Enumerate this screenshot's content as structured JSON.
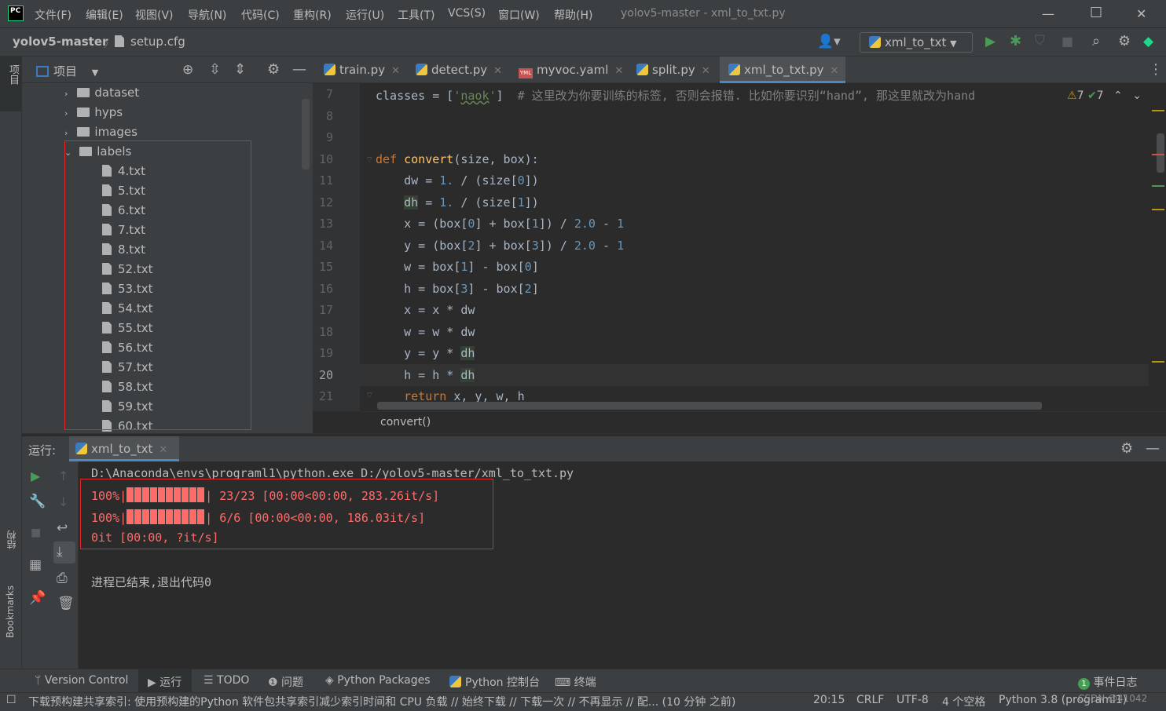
{
  "title_bar": {
    "logo": "PC",
    "menus": [
      "文件(F)",
      "编辑(E)",
      "视图(V)",
      "导航(N)",
      "代码(C)",
      "重构(R)",
      "运行(U)",
      "工具(T)",
      "VCS(S)",
      "窗口(W)",
      "帮助(H)"
    ],
    "window_title": "yolov5-master - xml_to_txt.py",
    "icons": [
      "minimize-icon",
      "maximize-icon",
      "close-icon"
    ]
  },
  "nav_bar": {
    "project": "yolov5-master",
    "separator": "〉",
    "file": "setup.cfg",
    "run_config": "xml_to_txt"
  },
  "left_strip": {
    "project_label": "项目",
    "structure_label": "结构",
    "bookmarks_label": "Bookmarks"
  },
  "project_panel": {
    "header": "项目",
    "folders": [
      "dataset",
      "hyps",
      "images",
      "labels"
    ],
    "files": [
      "4.txt",
      "5.txt",
      "6.txt",
      "7.txt",
      "8.txt",
      "52.txt",
      "53.txt",
      "54.txt",
      "55.txt",
      "56.txt",
      "57.txt",
      "58.txt",
      "59.txt",
      "60.txt"
    ]
  },
  "editor": {
    "tabs": [
      "train.py",
      "detect.py",
      "myvoc.yaml",
      "split.py",
      "xml_to_txt.py"
    ],
    "active_tab": "xml_to_txt.py",
    "line_numbers": [
      "7",
      "8",
      "9",
      "10",
      "11",
      "12",
      "13",
      "14",
      "15",
      "16",
      "17",
      "18",
      "19",
      "20",
      "21"
    ],
    "inspections": {
      "warnings": "7",
      "ok": "7"
    },
    "breadcrumb": "convert()"
  },
  "run_panel": {
    "label": "运行:",
    "tab": "xml_to_txt",
    "command": "D:\\Anaconda\\envs\\programl1\\python.exe D:/yolov5-master/xml_to_txt.py",
    "progress_lines": [
      {
        "pct": "100%|",
        "rest": "| 23/23 [00:00<00:00, 283.26it/s]"
      },
      {
        "pct": "100%|",
        "rest": "| 6/6 [00:00<00:00, 186.03it/s]"
      }
    ],
    "line3": "0it [00:00, ?it/s]",
    "exit_msg": "进程已结束,退出代码0"
  },
  "bottom_tabs": [
    "Version Control",
    "运行",
    "TODO",
    "问题",
    "Python Packages",
    "Python 控制台",
    "终端"
  ],
  "event_log": {
    "count": "1",
    "label": "事件日志"
  },
  "status_bar": {
    "message": "下载预构建共享索引: 使用预构建的Python 软件包共享索引减少索引时间和 CPU 负载 // 始终下载 // 下载一次 // 不再显示 // 配... (10 分钟 之前)",
    "position": "20:15",
    "line_sep": "CRLF",
    "encoding": "UTF-8",
    "indent": "4 个空格",
    "interpreter": "Python 3.8 (programl1)",
    "watermark": "CSDN @41042"
  }
}
